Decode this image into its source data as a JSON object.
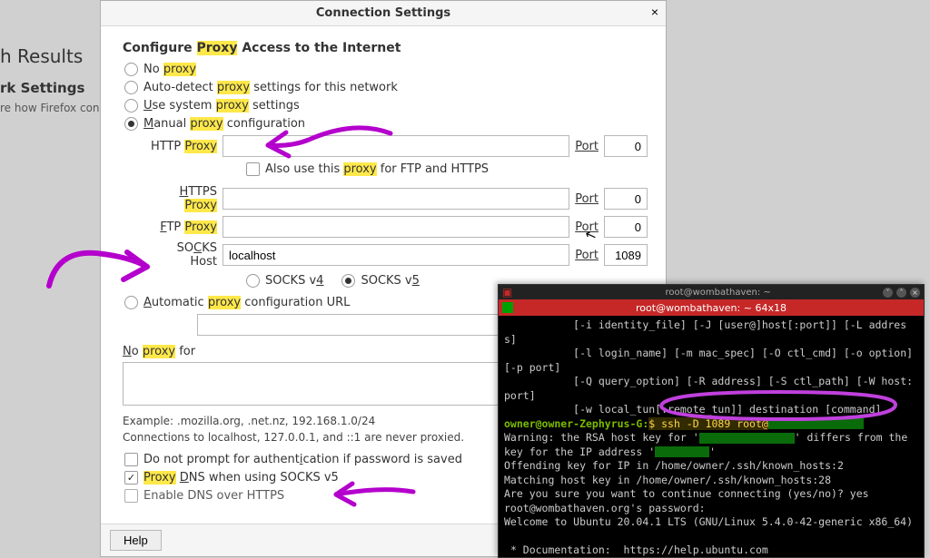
{
  "backdrop": {
    "results_heading": "h Results",
    "settings_heading": "rk Settings",
    "settings_sub": "re how Firefox conne"
  },
  "dialog": {
    "title": "Connection Settings",
    "section": "Configure Proxy Access to the Internet",
    "hl_proxy": "Proxy",
    "hl_proxy_lc": "proxy",
    "radios": {
      "no_pre": "No ",
      "auto_pre": "Auto-detect ",
      "auto_post": " settings for this network",
      "use_u": "U",
      "use_pre2": "se system ",
      "use_post": " settings",
      "man_u": "M",
      "man_pre2": "anual ",
      "man_post": " configuration",
      "pac_u": "A",
      "pac_pre2": "utomatic ",
      "pac_post": " configuration URL"
    },
    "proxy_rows": {
      "http_label_pre": "HTTP ",
      "https_u": "H",
      "https_label_pre2": "TTPS ",
      "ftp_u": "F",
      "ftp_label_pre2": "TP ",
      "socks_u": "C",
      "socks_label_pre": "SO",
      "socks_label_post": "KS Host",
      "port_u": "P",
      "port_post": "ort",
      "http_value": "",
      "http_port": "0",
      "also_pre": "Also use this ",
      "also_post": " for FTP and HTTPS",
      "https_value": "",
      "https_port": "0",
      "ftp_value": "",
      "ftp_port": "0",
      "socks_value": "localhost",
      "socks_port": "1089",
      "socks_v4_u": "4",
      "socks_v4": "SOCKS v",
      "socks_v5_u": "5",
      "socks_v5": "SOCKS v",
      "pac_value": ""
    },
    "noproxy": {
      "nu": "N",
      "label_pre2": "o ",
      "label_post": " for",
      "value": "",
      "example": "Example: .mozilla.org, .net.nz, 192.168.1.0/24",
      "never": "Connections to localhost, 127.0.0.1, and ::1 are never proxied."
    },
    "checks": {
      "noprompt_pre": "Do not prompt for authent",
      "noprompt_u": "i",
      "noprompt_post": "cation if password is saved",
      "dns_pre2": " ",
      "dns_u": "D",
      "dns_post": "NS when using SOCKS v5",
      "doh": "Enable DNS over HTTPS"
    },
    "help": "Help"
  },
  "terminal": {
    "wm_title": "root@wombathaven: ~",
    "titlebar": "root@wombathaven: ~ 64x18",
    "lines": {
      "l1": "           [-i identity_file] [-J [user@]host[:port]] [-L address]",
      "l2": "           [-l login_name] [-m mac_spec] [-O ctl_cmd] [-o option] [-p port]",
      "l3": "           [-Q query_option] [-R address] [-S ctl_path] [-W host:port]",
      "l4": "           [-w local_tun[:remote_tun]] destination [command]",
      "prompt": "owner@owner-Zephyrus-G:",
      "cmd_pre": "$ ssh -D 1089 root@",
      "l6a": "Warning: the RSA host key for '",
      "l6b": "' differs from the key for the IP address '",
      "l6c": "'",
      "l7": "Offending key for IP in /home/owner/.ssh/known_hosts:2",
      "l8": "Matching host key in /home/owner/.ssh/known_hosts:28",
      "l9": "Are you sure you want to continue connecting (yes/no)? yes",
      "l10": "root@wombathaven.org's password:",
      "l11": "Welcome to Ubuntu 20.04.1 LTS (GNU/Linux 5.4.0-42-generic x86_64)",
      "l12": "",
      "l13": " * Documentation:  https://help.ubuntu.com"
    }
  }
}
